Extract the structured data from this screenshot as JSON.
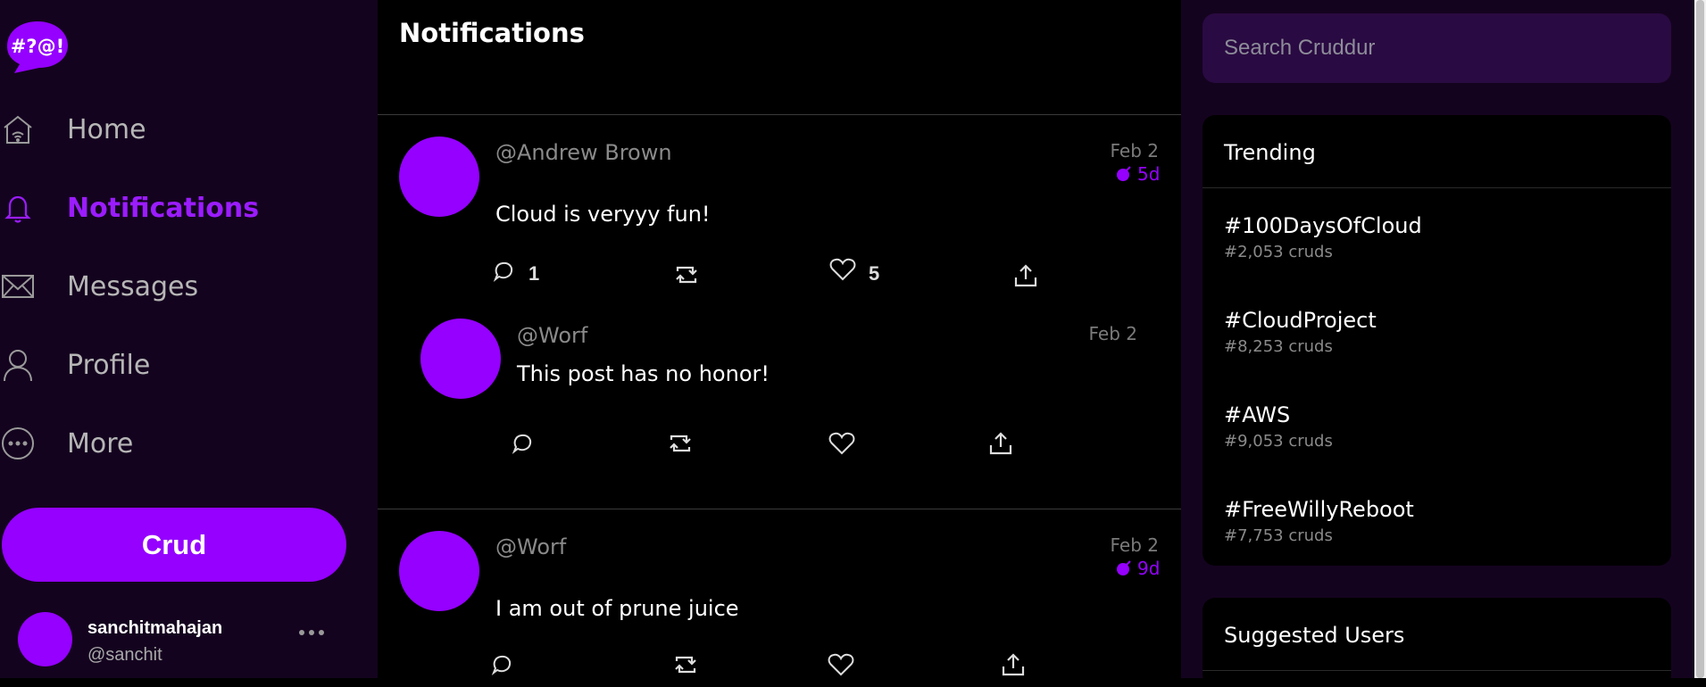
{
  "logo": {
    "text": "#?@!"
  },
  "nav": {
    "items": [
      {
        "label": "Home",
        "icon": "home-icon",
        "active": false
      },
      {
        "label": "Notifications",
        "icon": "bell-icon",
        "active": true
      },
      {
        "label": "Messages",
        "icon": "envelope-icon",
        "active": false
      },
      {
        "label": "Profile",
        "icon": "user-icon",
        "active": false
      },
      {
        "label": "More",
        "icon": "more-circle-icon",
        "active": false
      }
    ]
  },
  "crud_button": {
    "label": "Crud"
  },
  "profile": {
    "name": "sanchitmahajan",
    "handle": "@sanchit"
  },
  "feed": {
    "title": "Notifications",
    "posts": [
      {
        "handle": "@Andrew Brown",
        "date": "Feb 2",
        "expires": "5d",
        "message": "Cloud is veryyy fun!",
        "reply_count": "1",
        "like_count": "5"
      },
      {
        "handle": "@Worf",
        "date": "Feb 2",
        "message": "This post has no honor!"
      },
      {
        "handle": "@Worf",
        "date": "Feb 2",
        "expires": "9d",
        "message": "I am out of prune juice"
      }
    ]
  },
  "search": {
    "placeholder": "Search Cruddur"
  },
  "trending": {
    "title": "Trending",
    "items": [
      {
        "name": "#100DaysOfCloud",
        "count": "#2,053 cruds"
      },
      {
        "name": "#CloudProject",
        "count": "#8,253 cruds"
      },
      {
        "name": "#AWS",
        "count": "#9,053 cruds"
      },
      {
        "name": "#FreeWillyReboot",
        "count": "#7,753 cruds"
      }
    ]
  },
  "suggested": {
    "title": "Suggested Users"
  },
  "colors": {
    "accent": "#9500ff",
    "sidebar_bg": "#14031f",
    "feed_bg": "#000000"
  }
}
